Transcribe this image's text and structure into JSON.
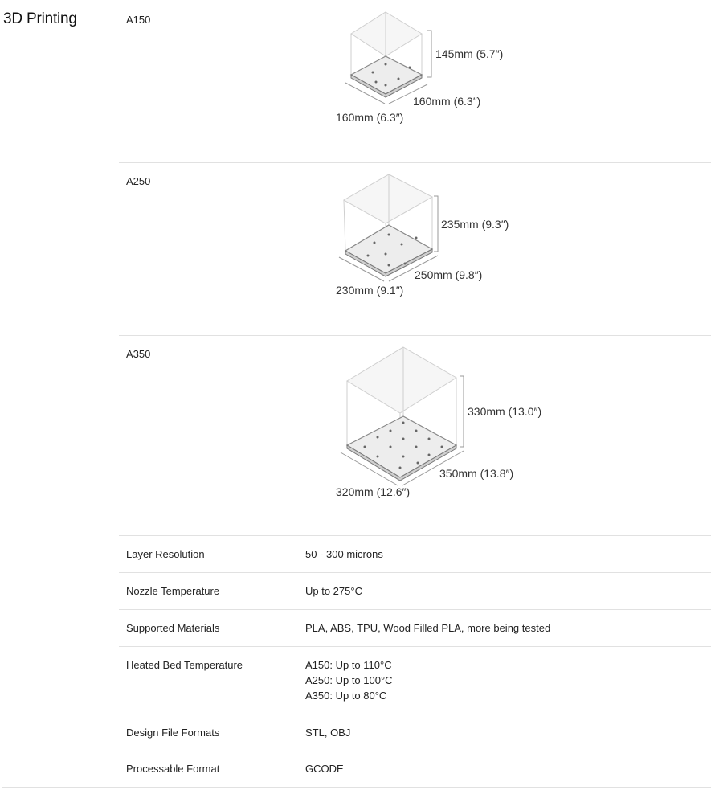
{
  "section": {
    "title": "3D Printing"
  },
  "models": [
    {
      "name": "A150",
      "height": "145mm (5.7″)",
      "depth": "160mm (6.3″)",
      "width": "160mm (6.3″)"
    },
    {
      "name": "A250",
      "height": "235mm (9.3″)",
      "depth": "250mm (9.8″)",
      "width": "230mm (9.1″)"
    },
    {
      "name": "A350",
      "height": "330mm (13.0″)",
      "depth": "350mm (13.8″)",
      "width": "320mm (12.6″)"
    }
  ],
  "specs": [
    {
      "label": "Layer Resolution",
      "values": [
        "50 - 300 microns"
      ]
    },
    {
      "label": "Nozzle Temperature",
      "values": [
        "Up to 275°C"
      ]
    },
    {
      "label": "Supported Materials",
      "values": [
        "PLA, ABS, TPU, Wood Filled PLA, more being tested"
      ]
    },
    {
      "label": "Heated Bed Temperature",
      "values": [
        "A150: Up to 110°C",
        "A250: Up to 100°C",
        "A350: Up to 80°C"
      ]
    },
    {
      "label": "Design File Formats",
      "values": [
        "STL, OBJ"
      ]
    },
    {
      "label": "Processable Format",
      "values": [
        "GCODE"
      ]
    }
  ]
}
